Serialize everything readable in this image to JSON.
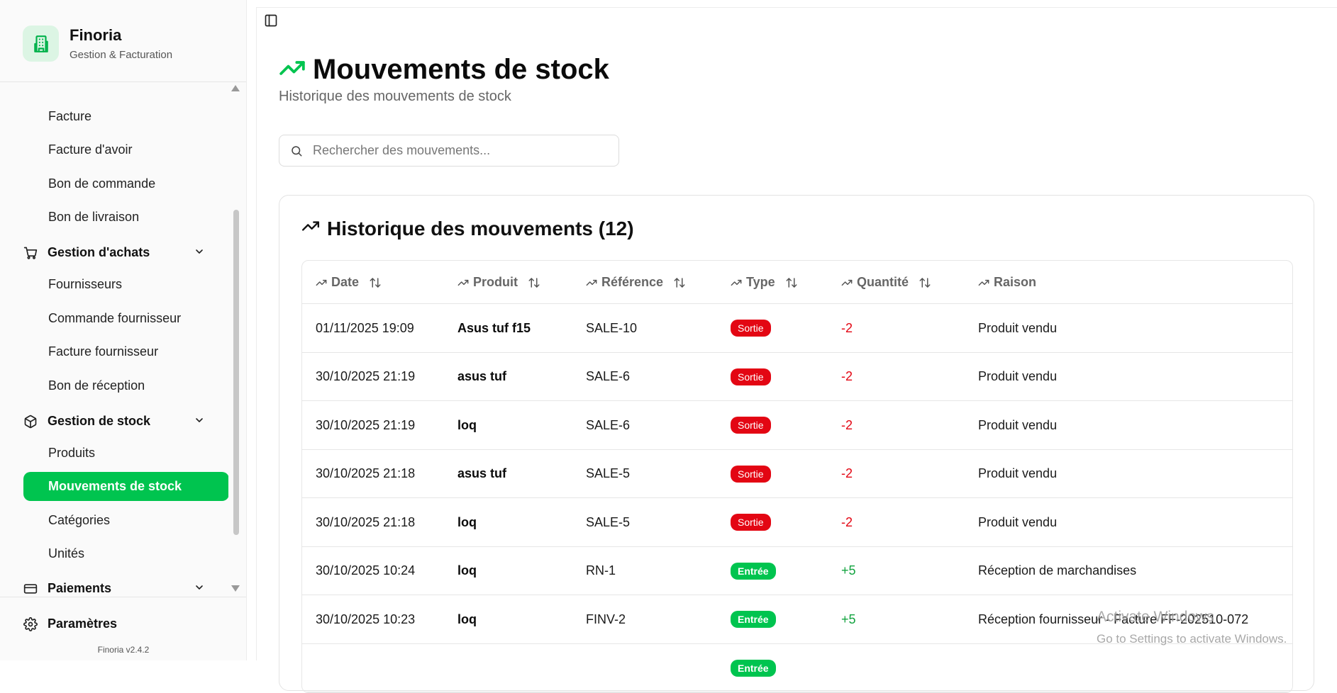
{
  "app": {
    "name": "Finoria",
    "tagline": "Gestion & Facturation",
    "version": "Finoria v2.4.2"
  },
  "sidebar": {
    "items": [
      {
        "label": "Facture",
        "kind": "sub"
      },
      {
        "label": "Facture d'avoir",
        "kind": "sub"
      },
      {
        "label": "Bon de commande",
        "kind": "sub"
      },
      {
        "label": "Bon de livraison",
        "kind": "sub"
      },
      {
        "label": "Gestion d'achats",
        "kind": "group",
        "icon": "cart-icon"
      },
      {
        "label": "Fournisseurs",
        "kind": "sub"
      },
      {
        "label": "Commande fournisseur",
        "kind": "sub"
      },
      {
        "label": "Facture fournisseur",
        "kind": "sub"
      },
      {
        "label": "Bon de réception",
        "kind": "sub"
      },
      {
        "label": "Gestion de stock",
        "kind": "group",
        "icon": "package-icon"
      },
      {
        "label": "Produits",
        "kind": "sub"
      },
      {
        "label": "Mouvements de stock",
        "kind": "sub",
        "active": true
      },
      {
        "label": "Catégories",
        "kind": "sub"
      },
      {
        "label": "Unités",
        "kind": "sub"
      },
      {
        "label": "Paiements",
        "kind": "group",
        "icon": "credit-card-icon"
      }
    ],
    "settings_label": "Paramètres"
  },
  "page": {
    "title": "Mouvements de stock",
    "subtitle": "Historique des mouvements de stock",
    "search_placeholder": "Rechercher des mouvements..."
  },
  "card": {
    "title": "Historique des mouvements (12)",
    "columns": [
      "Date",
      "Produit",
      "Référence",
      "Type",
      "Quantité",
      "Raison"
    ],
    "rows": [
      {
        "date": "01/11/2025 19:09",
        "product": "Asus tuf f15",
        "reference": "SALE-10",
        "type": "Sortie",
        "quantity": "-2",
        "reason": "Produit vendu"
      },
      {
        "date": "30/10/2025 21:19",
        "product": "asus tuf",
        "reference": "SALE-6",
        "type": "Sortie",
        "quantity": "-2",
        "reason": "Produit vendu"
      },
      {
        "date": "30/10/2025 21:19",
        "product": "loq",
        "reference": "SALE-6",
        "type": "Sortie",
        "quantity": "-2",
        "reason": "Produit vendu"
      },
      {
        "date": "30/10/2025 21:18",
        "product": "asus tuf",
        "reference": "SALE-5",
        "type": "Sortie",
        "quantity": "-2",
        "reason": "Produit vendu"
      },
      {
        "date": "30/10/2025 21:18",
        "product": "loq",
        "reference": "SALE-5",
        "type": "Sortie",
        "quantity": "-2",
        "reason": "Produit vendu"
      },
      {
        "date": "30/10/2025 10:24",
        "product": "loq",
        "reference": "RN-1",
        "type": "Entrée",
        "quantity": "+5",
        "reason": "Réception de marchandises"
      },
      {
        "date": "30/10/2025 10:23",
        "product": "loq",
        "reference": "FINV-2",
        "type": "Entrée",
        "quantity": "+5",
        "reason": "Réception fournisseur - Facture FF-202510-072"
      },
      {
        "date": "",
        "product": "",
        "reference": "",
        "type": "Entrée",
        "quantity": "",
        "reason": ""
      }
    ]
  },
  "watermark": {
    "line1": "Activate Windows",
    "line2": "Go to Settings to activate Windows."
  },
  "colors": {
    "accent": "#00c44f",
    "danger": "#e30613",
    "positive": "#12a33f"
  }
}
